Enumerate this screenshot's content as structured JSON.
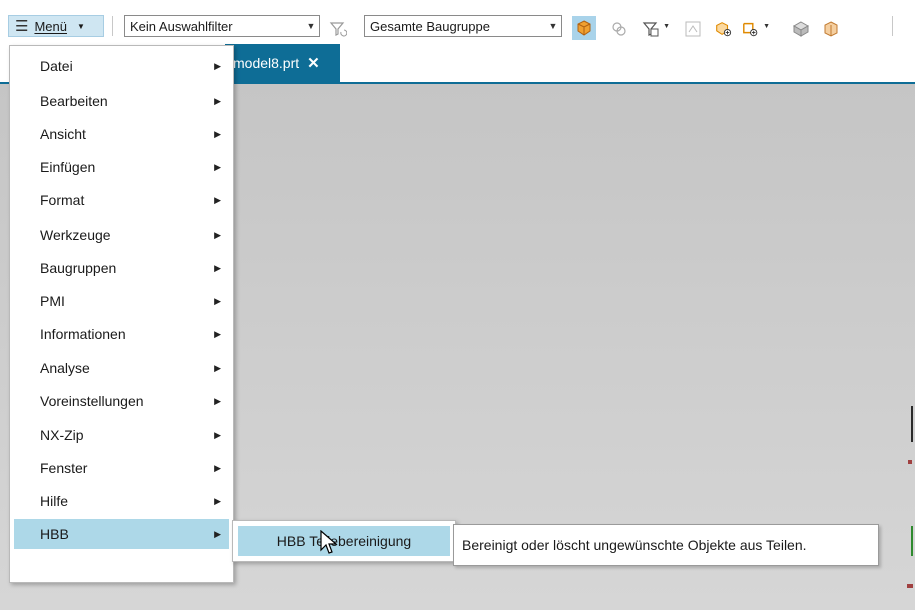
{
  "toolbar": {
    "menu_label": "Menü",
    "filter_combo": {
      "value": "Kein Auswahlfilter"
    },
    "scope_combo": {
      "value": "Gesamte Baugruppe"
    },
    "icons": [
      "funnel-reset-icon",
      "orange-cube-icon",
      "deselect-icon",
      "feature-filter-icon",
      "snap-icon",
      "cube-add-icon",
      "point-add-icon",
      "gray-sphere-icon",
      "part-icon"
    ]
  },
  "tab": {
    "label": "model8.prt",
    "close_glyph": "✕"
  },
  "menu": {
    "items": [
      {
        "label": "Datei"
      },
      {
        "label": "Bearbeiten"
      },
      {
        "label": "Ansicht"
      },
      {
        "label": "Einfügen"
      },
      {
        "label": "Format"
      },
      {
        "label": "Werkzeuge"
      },
      {
        "label": "Baugruppen"
      },
      {
        "label": "PMI"
      },
      {
        "label": "Informationen"
      },
      {
        "label": "Analyse"
      },
      {
        "label": "Voreinstellungen"
      },
      {
        "label": "NX-Zip"
      },
      {
        "label": "Fenster"
      },
      {
        "label": "Hilfe"
      },
      {
        "label": "HBB"
      }
    ]
  },
  "submenu": {
    "item_label": "HBB Teilebereinigung"
  },
  "tooltip": {
    "text": "Bereinigt oder löscht ungewünschte Objekte aus Teilen."
  },
  "colors": {
    "accent": "#0e6d96",
    "highlight": "#add8e8",
    "menu_button": "#cfe6f2"
  }
}
